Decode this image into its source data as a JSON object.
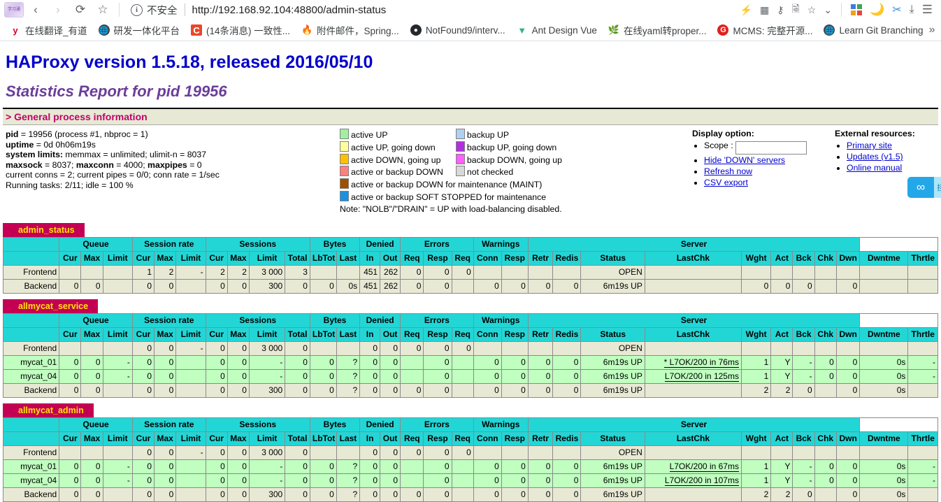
{
  "browser": {
    "tab_favicon_text": "学习通",
    "nav": {
      "back": "‹",
      "forward": "›",
      "reload": "⟳",
      "bookmark": "☆"
    },
    "security_label": "不安全",
    "url": "http://192.168.92.104:48800/admin-status",
    "toolbar_icons": [
      "flash-icon",
      "grid-icon",
      "key-icon",
      "translate-icon",
      "star-icon",
      "chevron-down-icon",
      "apps-icon",
      "moon-icon",
      "scissors-icon",
      "download-icon",
      "menu-icon"
    ],
    "bookmarks": [
      {
        "icon": "y",
        "icon_color": "#d6002b",
        "label": "在线翻译_有道"
      },
      {
        "icon": "globe",
        "icon_color": "#444444",
        "label": "研发一体化平台"
      },
      {
        "icon": "C",
        "icon_color": "#e8472a",
        "label": "(14条消息) 一致性..."
      },
      {
        "icon": "flame",
        "icon_color": "#e8472a",
        "label": "附件邮件，Spring..."
      },
      {
        "icon": "github",
        "icon_color": "#24292e",
        "label": "NotFound9/interv..."
      },
      {
        "icon": "V",
        "icon_color": "#34b37e",
        "label": "Ant Design Vue"
      },
      {
        "icon": "leaf",
        "icon_color": "#8bc34a",
        "label": "在线yaml转proper..."
      },
      {
        "icon": "G",
        "icon_color": "#e02020",
        "label": "MCMS: 完整开源..."
      },
      {
        "icon": "globe",
        "icon_color": "#444444",
        "label": "Learn Git Branching"
      }
    ],
    "bookmarks_overflow": "»"
  },
  "page": {
    "title": "HAProxy version 1.5.18, released 2016/05/10",
    "subtitle": "Statistics Report for pid 19956",
    "section_header": "> General process information"
  },
  "process_info": {
    "lines": [
      {
        "bold": "pid",
        "rest": " = 19956 (process #1, nbproc = 1)"
      },
      {
        "bold": "uptime",
        "rest": " = 0d 0h06m19s"
      },
      {
        "bold": "system limits:",
        "rest": " memmax = unlimited; ulimit-n = 8037"
      },
      {
        "bold": "maxsock",
        "rest": " = 8037; maxconn = 4000; maxpipes = 0"
      },
      {
        "bold": "",
        "rest": "current conns = 2; current pipes = 0/0; conn rate = 1/sec"
      },
      {
        "bold": "",
        "rest": "Running tasks: 2/11; idle = 100 %"
      }
    ],
    "maxsock_line_bolds": [
      "maxsock",
      "maxconn",
      "maxpipes"
    ]
  },
  "legend": {
    "rows": [
      {
        "left_color": "#a0f0a0",
        "left_label": "active UP",
        "right_color": "#b0d0f0",
        "right_label": "backup UP"
      },
      {
        "left_color": "#ffffa0",
        "left_label": "active UP, going down",
        "right_color": "#b030e0",
        "right_label": "backup UP, going down"
      },
      {
        "left_color": "#ffc000",
        "left_label": "active DOWN, going up",
        "right_color": "#ff60ff",
        "right_label": "backup DOWN, going up"
      },
      {
        "left_color": "#ff8080",
        "left_label": "active or backup DOWN",
        "right_color": "#d8d8d8",
        "right_label": "not checked"
      }
    ],
    "wide_rows": [
      {
        "color": "#a05000",
        "label": "active or backup DOWN for maintenance (MAINT)"
      },
      {
        "color": "#1a90e0",
        "label": "active or backup SOFT STOPPED for maintenance"
      }
    ],
    "note": "Note: \"NOLB\"/\"DRAIN\" = UP with load-balancing disabled."
  },
  "display_option": {
    "heading": "Display option:",
    "scope_label": "Scope :",
    "scope_value": "",
    "scope_placeholder": "",
    "links": [
      "Hide 'DOWN' servers",
      "Refresh now",
      "CSV export"
    ]
  },
  "external_resources": {
    "heading": "External resources:",
    "links": [
      "Primary site",
      "Updates (v1.5)",
      "Online manual"
    ]
  },
  "floating_widget": {
    "icon": "infinity-icon",
    "tail_text": "挂"
  },
  "table_headers": {
    "groups": [
      "Queue",
      "Session rate",
      "Sessions",
      "Bytes",
      "Denied",
      "Errors",
      "Warnings",
      "Server"
    ],
    "sub": [
      "Cur",
      "Max",
      "Limit",
      "Cur",
      "Max",
      "Limit",
      "Cur",
      "Max",
      "Limit",
      "Total",
      "LbTot",
      "Last",
      "In",
      "Out",
      "Req",
      "Resp",
      "Req",
      "Conn",
      "Resp",
      "Retr",
      "Redis",
      "Status",
      "LastChk",
      "Wght",
      "Act",
      "Bck",
      "Chk",
      "Dwn",
      "Dwntme",
      "Thrtle"
    ]
  },
  "proxies": [
    {
      "name": "admin_status",
      "rows": [
        {
          "type": "frontend",
          "name": "Frontend",
          "cells": [
            "",
            "",
            "",
            "1",
            "2",
            "-",
            "2",
            "2",
            "3 000",
            "3",
            "",
            "",
            "451",
            "262",
            "0",
            "0",
            "0",
            "",
            "",
            "",
            "",
            "OPEN",
            "",
            "",
            "",
            "",
            "",
            "",
            "",
            ""
          ]
        },
        {
          "type": "backend",
          "name": "Backend",
          "cells": [
            "0",
            "0",
            "",
            "0",
            "0",
            "",
            "0",
            "0",
            "300",
            "0",
            "0",
            "0s",
            "451",
            "262",
            "0",
            "0",
            "",
            "0",
            "0",
            "0",
            "0",
            "6m19s UP",
            "",
            "0",
            "0",
            "0",
            "",
            "0",
            "",
            ""
          ]
        }
      ]
    },
    {
      "name": "allmycat_service",
      "rows": [
        {
          "type": "frontend",
          "name": "Frontend",
          "cells": [
            "",
            "",
            "",
            "0",
            "0",
            "-",
            "0",
            "0",
            "3 000",
            "0",
            "",
            "",
            "0",
            "0",
            "0",
            "0",
            "0",
            "",
            "",
            "",
            "",
            "OPEN",
            "",
            "",
            "",
            "",
            "",
            "",
            "",
            ""
          ]
        },
        {
          "type": "server",
          "name": "mycat_01",
          "cells": [
            "0",
            "0",
            "-",
            "0",
            "0",
            "",
            "0",
            "0",
            "-",
            "0",
            "0",
            "?",
            "0",
            "0",
            "",
            "0",
            "",
            "0",
            "0",
            "0",
            "0",
            "6m19s UP",
            "* L7OK/200 in 76ms",
            "1",
            "Y",
            "-",
            "0",
            "0",
            "0s",
            "-"
          ]
        },
        {
          "type": "server",
          "name": "mycat_04",
          "cells": [
            "0",
            "0",
            "-",
            "0",
            "0",
            "",
            "0",
            "0",
            "-",
            "0",
            "0",
            "?",
            "0",
            "0",
            "",
            "0",
            "",
            "0",
            "0",
            "0",
            "0",
            "6m19s UP",
            "L7OK/200 in 125ms",
            "1",
            "Y",
            "-",
            "0",
            "0",
            "0s",
            "-"
          ]
        },
        {
          "type": "backend",
          "name": "Backend",
          "cells": [
            "0",
            "0",
            "",
            "0",
            "0",
            "",
            "0",
            "0",
            "300",
            "0",
            "0",
            "?",
            "0",
            "0",
            "0",
            "0",
            "",
            "0",
            "0",
            "0",
            "0",
            "6m19s UP",
            "",
            "2",
            "2",
            "0",
            "",
            "0",
            "0s",
            ""
          ]
        }
      ]
    },
    {
      "name": "allmycat_admin",
      "rows": [
        {
          "type": "frontend",
          "name": "Frontend",
          "cells": [
            "",
            "",
            "",
            "0",
            "0",
            "-",
            "0",
            "0",
            "3 000",
            "0",
            "",
            "",
            "0",
            "0",
            "0",
            "0",
            "0",
            "",
            "",
            "",
            "",
            "OPEN",
            "",
            "",
            "",
            "",
            "",
            "",
            "",
            ""
          ]
        },
        {
          "type": "server",
          "name": "mycat_01",
          "cells": [
            "0",
            "0",
            "-",
            "0",
            "0",
            "",
            "0",
            "0",
            "-",
            "0",
            "0",
            "?",
            "0",
            "0",
            "",
            "0",
            "",
            "0",
            "0",
            "0",
            "0",
            "6m19s UP",
            "L7OK/200 in 67ms",
            "1",
            "Y",
            "-",
            "0",
            "0",
            "0s",
            "-"
          ]
        },
        {
          "type": "server",
          "name": "mycat_04",
          "cells": [
            "0",
            "0",
            "-",
            "0",
            "0",
            "",
            "0",
            "0",
            "-",
            "0",
            "0",
            "?",
            "0",
            "0",
            "",
            "0",
            "",
            "0",
            "0",
            "0",
            "0",
            "6m19s UP",
            "L7OK/200 in 107ms",
            "1",
            "Y",
            "-",
            "0",
            "0",
            "0s",
            "-"
          ]
        },
        {
          "type": "backend",
          "name": "Backend",
          "cells": [
            "0",
            "0",
            "",
            "0",
            "0",
            "",
            "0",
            "0",
            "300",
            "0",
            "0",
            "?",
            "0",
            "0",
            "0",
            "0",
            "",
            "0",
            "0",
            "0",
            "0",
            "6m19s UP",
            "",
            "2",
            "2",
            "0",
            "",
            "0",
            "0s",
            ""
          ]
        }
      ]
    }
  ],
  "colors": {
    "title_blue": "#0000cc",
    "subtitle_purple": "#6a3d9a",
    "section_pink": "#c0006b",
    "header_cyan": "#23d6d6",
    "row_beige": "#e8e9d4",
    "row_green": "#c0ffc0",
    "proxy_title_bg": "#c40055",
    "proxy_title_fg": "#ffe400"
  }
}
